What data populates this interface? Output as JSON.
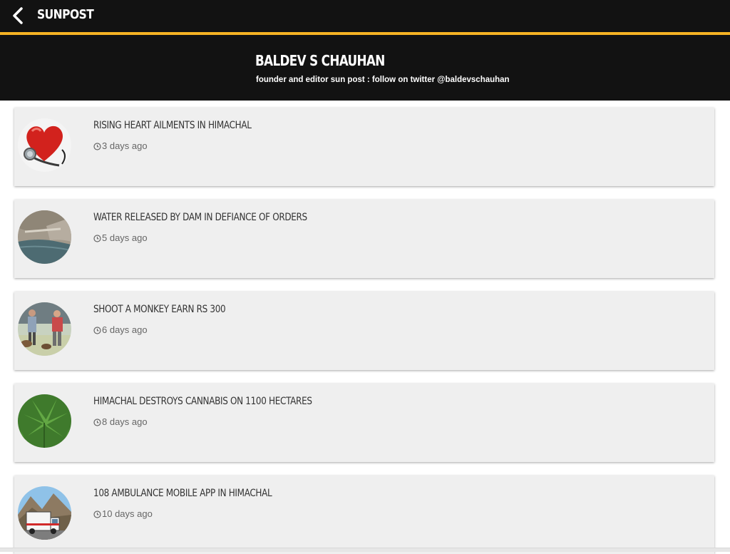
{
  "app": {
    "title": "SUNPOST"
  },
  "profile": {
    "name": "BALDEV S CHAUHAN",
    "bio": "founder and editor sun post : follow on twitter @baldevschauhan"
  },
  "colors": {
    "accent": "#f5b324",
    "header_bg": "#121212",
    "card_bg": "#efefef"
  },
  "posts": [
    {
      "title": "RISING HEART AILMENTS IN HIMACHAL",
      "time": "3 days ago",
      "thumbnail": "heart-stethoscope"
    },
    {
      "title": "WATER RELEASED BY DAM IN DEFIANCE OF ORDERS",
      "time": "5 days ago",
      "thumbnail": "dam-reservoir"
    },
    {
      "title": "SHOOT A MONKEY EARN RS 300",
      "time": "6 days ago",
      "thumbnail": "people-with-monkeys"
    },
    {
      "title": "HIMACHAL DESTROYS CANNABIS ON 1100 HECTARES",
      "time": "8 days ago",
      "thumbnail": "cannabis-leaves"
    },
    {
      "title": "108 AMBULANCE MOBILE APP IN HIMACHAL",
      "time": "10 days ago",
      "thumbnail": "ambulance-mountains"
    }
  ]
}
